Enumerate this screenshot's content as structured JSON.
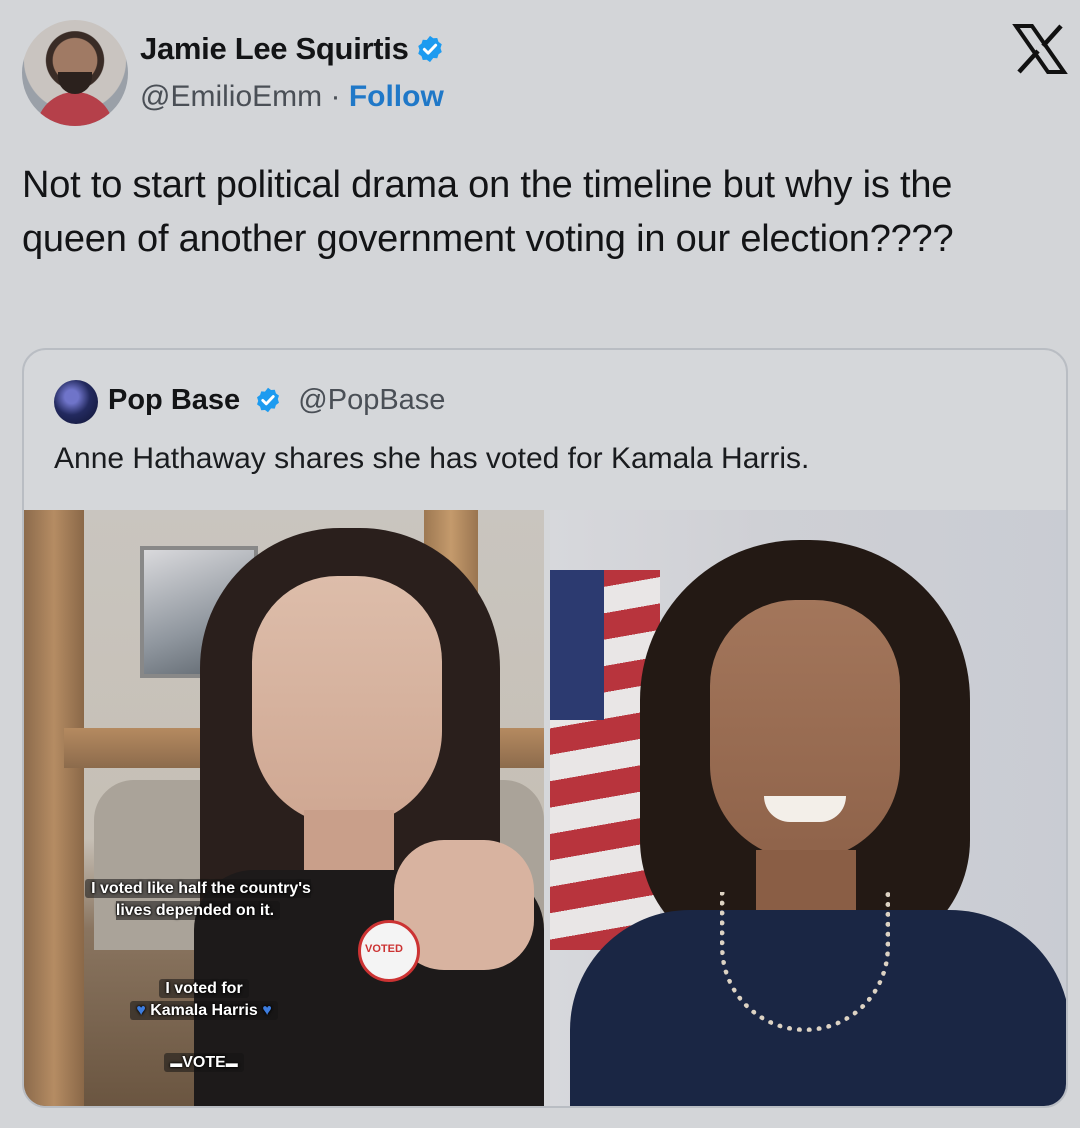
{
  "author": {
    "display_name": "Jamie Lee Squirtis",
    "handle": "@EmilioEmm",
    "separator": "·",
    "follow_label": "Follow",
    "verified": true,
    "badge_color": "#1d9bf0"
  },
  "platform_logo": "x-logo-icon",
  "tweet": {
    "text": "Not to start political drama on the timeline but why is the queen of another government voting in our election????"
  },
  "quoted_tweet": {
    "display_name": "Pop Base",
    "handle": "@PopBase",
    "verified": true,
    "text": "Anne Hathaway shares she has voted for Kamala Harris.",
    "left_photo": {
      "caption_1": "I voted like half the country's lives depended on it.",
      "caption_2_line1": "I voted for",
      "caption_2_line2": "Kamala Harris",
      "caption_3": "VOTE",
      "sticker_text": "VOTED"
    },
    "right_photo": {}
  }
}
